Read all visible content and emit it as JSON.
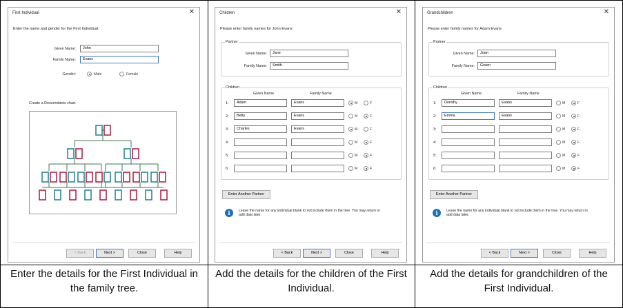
{
  "colors": {
    "teal": "#1f7e8c",
    "crimson": "#b0153b",
    "tree_line": "#3e7a4b",
    "focus": "#3b78c6",
    "info": "#1f6fbf"
  },
  "panel1": {
    "title": "First Individual",
    "instruction": "Enter the name and gender for the First Individual.",
    "given_label": "Given Name:",
    "given_value": "John",
    "family_label": "Family Name:",
    "family_value": "Evans",
    "gender_label": "Gender:",
    "male": "Male",
    "female": "Female",
    "selected_gender": "Male",
    "chart_label": "Create a Descendants chart.",
    "buttons": {
      "back": "< Back",
      "next": "Next >",
      "close": "Close",
      "help": "Help"
    }
  },
  "panel2": {
    "title": "Children",
    "instruction": "Please enter family names for John Evans",
    "partner_legend": "Partner",
    "given_label": "Given Name:",
    "given_value": "Jane",
    "family_label": "Family Name:",
    "family_value": "Smith",
    "children_legend": "Children",
    "col_given": "Given Name",
    "col_family": "Family Name",
    "male": "M",
    "female": "F",
    "rows": [
      {
        "num": "1:",
        "given": "Adam",
        "family": "Evans",
        "sex": "M"
      },
      {
        "num": "2:",
        "given": "Betty",
        "family": "Evans",
        "sex": "F"
      },
      {
        "num": "3:",
        "given": "Charles",
        "family": "Evans",
        "sex": "M"
      },
      {
        "num": "4:",
        "given": "",
        "family": "",
        "sex": "F"
      },
      {
        "num": "5:",
        "given": "",
        "family": "",
        "sex": "F"
      },
      {
        "num": "6:",
        "given": "",
        "family": "",
        "sex": "F"
      }
    ],
    "another_partner": "Enter Another Partner",
    "note": "Leave the name for any individual blank to not include them in the tree. You may return to add data later.",
    "buttons": {
      "back": "< Back",
      "next": "Next >",
      "close": "Close",
      "help": "Help"
    }
  },
  "panel3": {
    "title": "Grandchildren",
    "instruction": "Please enter family names for Adam Evans",
    "partner_legend": "Partner",
    "given_label": "Given Name:",
    "given_value": "Joan",
    "family_label": "Family Name:",
    "family_value": "Green",
    "children_legend": "Children",
    "col_given": "Given Name",
    "col_family": "Family Name",
    "male": "M",
    "female": "F",
    "rows": [
      {
        "num": "1:",
        "given": "Dorothy",
        "family": "Evans",
        "sex": "F"
      },
      {
        "num": "2:",
        "given": "Emma",
        "family": "Evans",
        "sex": "F"
      },
      {
        "num": "3:",
        "given": "",
        "family": "",
        "sex": "F"
      },
      {
        "num": "4:",
        "given": "",
        "family": "",
        "sex": "F"
      },
      {
        "num": "5:",
        "given": "",
        "family": "",
        "sex": "F"
      },
      {
        "num": "6:",
        "given": "",
        "family": "",
        "sex": "F"
      }
    ],
    "another_partner": "Enter Another Partner",
    "note": "Leave the name for any individual blank to not include them in the tree. You may return to add data later.",
    "buttons": {
      "back": "< Back",
      "next": "Next >",
      "close": "Close",
      "help": "Help"
    }
  },
  "captions": [
    "Enter the details for the First Individual in the family tree.",
    "Add the details for the children of the First Individual.",
    "Add the details for grandchildren of the First Individual."
  ]
}
